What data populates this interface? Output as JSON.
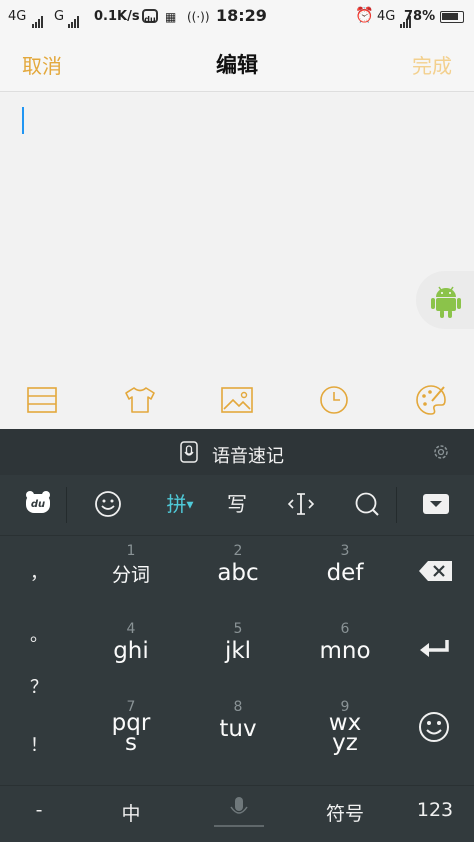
{
  "status_bar": {
    "net1": "4G",
    "net2": "G",
    "speed": "0.1K/s",
    "du_badge": "du",
    "time": "18:29",
    "net3": "4G",
    "battery": "78%"
  },
  "header": {
    "cancel_label": "取消",
    "title": "编辑",
    "done_label": "完成"
  },
  "colors": {
    "accent": "#e3a83c",
    "accent_disabled": "#f3d08e",
    "cursor": "#2196f3",
    "keyboard_bg": "#323a3d",
    "android_green": "#8bc34a",
    "pinyin_active": "#4fc9d8"
  },
  "editor": {
    "toolbar": [
      "list-icon",
      "shirt-icon",
      "image-icon",
      "clock-icon",
      "palette-icon"
    ]
  },
  "keyboard": {
    "voice_label": "语音速记",
    "func_keys": {
      "logo": "du",
      "emoji": "emoji-icon",
      "pinyin": "拼",
      "handwrite": "写",
      "cursor": "cursor-move-icon",
      "search": "search-icon",
      "hide": "hide-keyboard-icon"
    },
    "left_column": [
      "，",
      "。",
      "？",
      "！"
    ],
    "keys": [
      {
        "num": "1",
        "label": "分词"
      },
      {
        "num": "2",
        "label": "abc"
      },
      {
        "num": "3",
        "label": "def"
      },
      {
        "num": "4",
        "label": "ghi"
      },
      {
        "num": "5",
        "label": "jkl"
      },
      {
        "num": "6",
        "label": "mno"
      },
      {
        "num": "7",
        "label": "pqrs"
      },
      {
        "num": "8",
        "label": "tuv"
      },
      {
        "num": "9",
        "label": "wxyz"
      }
    ],
    "bottom": {
      "dash": "-",
      "zh": "中",
      "symbols": "符号",
      "numbers": "123"
    }
  }
}
